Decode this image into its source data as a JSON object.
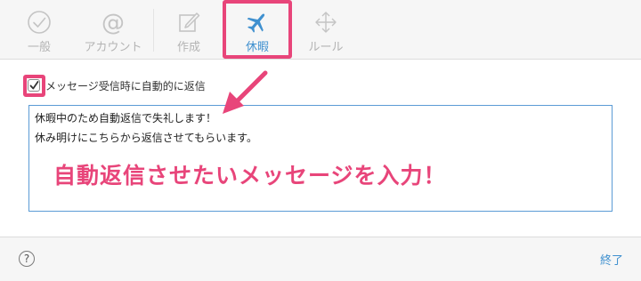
{
  "toolbar": {
    "tabs": [
      {
        "label": "一般",
        "icon": "checkmark-circle-icon"
      },
      {
        "label": "アカウント",
        "icon": "at-sign-icon"
      },
      {
        "label": "作成",
        "icon": "compose-icon"
      },
      {
        "label": "休暇",
        "icon": "airplane-icon",
        "active": true
      },
      {
        "label": "ルール",
        "icon": "move-arrows-icon"
      }
    ],
    "active_color": "#3f90cf",
    "inactive_color": "#b4b4b4"
  },
  "vacation": {
    "auto_reply_label": "メッセージ受信時に自動的に返信",
    "auto_reply_checked": true,
    "message_lines": [
      "休暇中のため自動返信で失礼します！",
      "休み明けにこちらから返信させてもらいます。"
    ]
  },
  "annotation": {
    "text": "自動返信させたいメッセージを入力！",
    "color": "#e8457a"
  },
  "footer": {
    "help_label": "?",
    "done_label": "終了"
  }
}
